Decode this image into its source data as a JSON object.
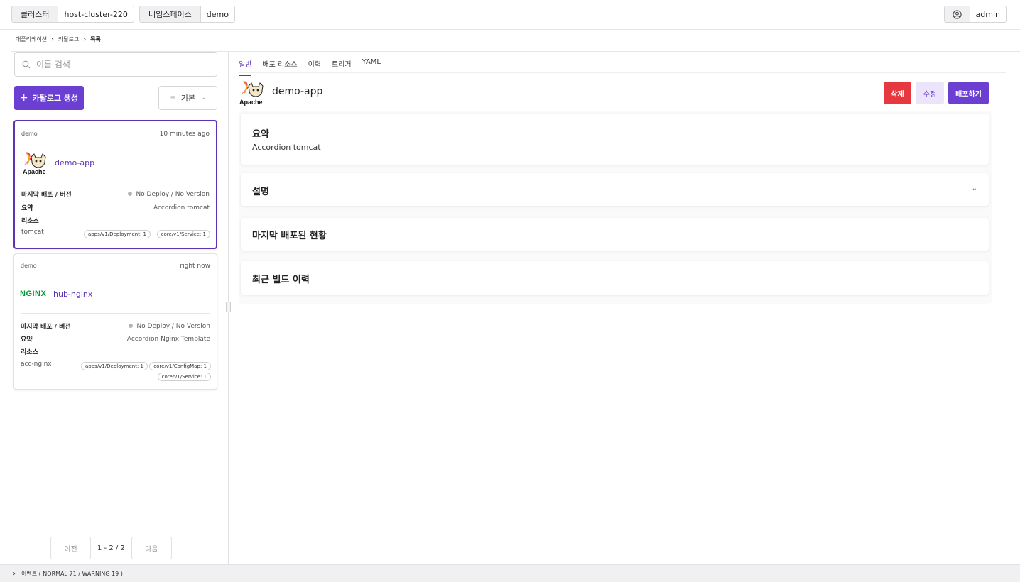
{
  "topbar": {
    "cluster_label": "클러스터",
    "cluster_value": "host-cluster-220",
    "namespace_label": "네임스페이스",
    "namespace_value": "demo",
    "user_name": "admin",
    "user_icon": "user-circle-icon"
  },
  "breadcrumb": [
    "애플리케이션",
    "카탈로그",
    "목록"
  ],
  "left": {
    "search_placeholder": "이름 검색",
    "create_label": "카탈로그 생성",
    "sort_label": "기본",
    "cards": [
      {
        "namespace": "demo",
        "time": "10 minutes ago",
        "name": "demo-app",
        "logo": "apache-tomcat-logo",
        "deploy_label": "마지막 배포 / 버전",
        "deploy_value": "No Deploy / No Version",
        "summary_label": "요약",
        "summary_value": "Accordion tomcat",
        "resources_label": "리소스",
        "resource_name": "tomcat",
        "pills": [
          "apps/v1/Deployment: 1",
          "core/v1/Service: 1"
        ]
      },
      {
        "namespace": "demo",
        "time": "right now",
        "name": "hub-nginx",
        "logo": "NGINX",
        "deploy_label": "마지막 배포 / 버전",
        "deploy_value": "No Deploy / No Version",
        "summary_label": "요약",
        "summary_value": "Accordion Nginx Template",
        "resources_label": "리소스",
        "resource_name": "acc-nginx",
        "pills": [
          "apps/v1/Deployment: 1",
          "core/v1/ConfigMap: 1",
          "core/v1/Service: 1"
        ]
      }
    ],
    "pager": {
      "prev": "이전",
      "info": "1 - 2 / 2",
      "next": "다음"
    }
  },
  "detail": {
    "tabs": [
      "일반",
      "배포 리소스",
      "이력",
      "트리거",
      "YAML"
    ],
    "active_tab": "일반",
    "title": "demo-app",
    "delete_label": "삭제",
    "edit_label": "수정",
    "deploy_label": "배포하기",
    "sections": [
      {
        "heading": "요약",
        "body": "Accordion tomcat"
      },
      {
        "heading": "설명"
      },
      {
        "heading": "마지막 배포된 현황"
      },
      {
        "heading": "최근 빌드 이력"
      }
    ]
  },
  "events_bar": "이벤트 ( NORMAL 71 / WARNING 19 )",
  "colors": {
    "accent": "#6a3fd1",
    "danger": "#e8383f",
    "nginx": "#009639"
  }
}
